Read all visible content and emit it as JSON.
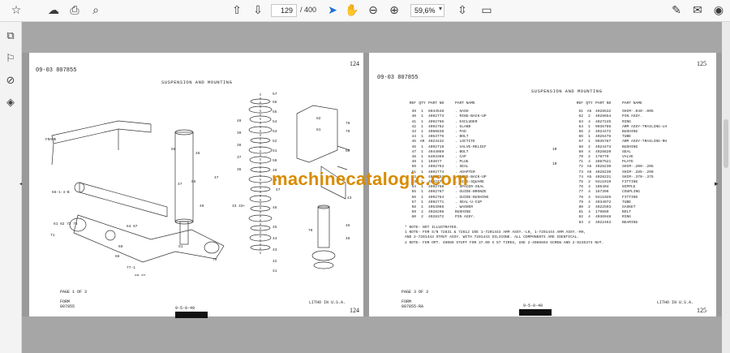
{
  "toolbar": {
    "current_page": "129",
    "total_pages": "/ 400",
    "zoom": "59,6%"
  },
  "left_page": {
    "header": "09-03  807855",
    "page_number_top": "124",
    "page_number_bottom": "124",
    "title": "SUSPENSION AND MOUNTING",
    "page_of": "PAGE 1 OF 3",
    "form_label": "FORM",
    "form_number": "807855",
    "date": "9-5-0-49",
    "litho": "LITHO IN U.S.A."
  },
  "right_page": {
    "header": "09-03  807855",
    "page_number_top": "125",
    "page_number_bottom": "125",
    "title": "SUSPENSION AND MOUNTING",
    "page_of": "PAGE 3 OF 3",
    "form_label": "FORM",
    "form_number": "807855-RA",
    "date": "9-5-0-49",
    "litho": "LITHO IN U.S.A.",
    "table_headers": {
      "ref": "REF",
      "qty": "QTY",
      "part": "PART NO",
      "name": "PART NAME"
    },
    "table_left": [
      {
        "ref": "39",
        "qty": "1",
        "part": "6044548",
        "name": ". HASH"
      },
      {
        "ref": "40",
        "qty": "1",
        "part": "4092773",
        "name": ". RING-BACK-UP"
      },
      {
        "ref": "41",
        "qty": "1",
        "part": "4092766",
        "name": ". EXCLUDER"
      },
      {
        "ref": "42",
        "qty": "1",
        "part": "4092762",
        "name": ". GLAND"
      },
      {
        "ref": "43",
        "qty": "1",
        "part": "4060838",
        "name": ". PAD"
      },
      {
        "ref": "44",
        "qty": "1",
        "part": "4053776",
        "name": ". BOLT"
      },
      {
        "ref": "45",
        "qty": "AR",
        "part": "4023432",
        "name": ". LOCTITE"
      },
      {
        "ref": "46",
        "qty": "1",
        "part": "4092719",
        "name": ". VALVE-RELIEF"
      },
      {
        "ref": "47",
        "qty": "1",
        "part": "4044059",
        "name": ". BOLT"
      },
      {
        "ref": "48",
        "qty": "1",
        "part": "8403369",
        "name": ". CAP"
      },
      {
        "ref": "49",
        "qty": "1",
        "part": "103677",
        "name": ". PLUG"
      },
      {
        "ref": "50",
        "qty": "1",
        "part": "4092763",
        "name": ". SEAL"
      },
      {
        "ref": "51",
        "qty": "1",
        "part": "4092774",
        "name": ". ADAPTER"
      },
      {
        "ref": "52",
        "qty": "1",
        "part": "4092753",
        "name": ". RING-BACK-UP"
      },
      {
        "ref": "53",
        "qty": "1",
        "part": "4092775",
        "name": ". RING-SQUARE"
      },
      {
        "ref": "54",
        "qty": "1",
        "part": "4092760",
        "name": ". SPACER-SEAL"
      },
      {
        "ref": "55",
        "qty": "1",
        "part": "4092767",
        "name": ". GUIDE-BRONZE"
      },
      {
        "ref": "56",
        "qty": "1",
        "part": "4092764",
        "name": ". GUIDE-BUSHING"
      },
      {
        "ref": "57",
        "qty": "1",
        "part": "4092771",
        "name": ". SEAL-U-CUP"
      },
      {
        "ref": "58",
        "qty": "1",
        "part": "4053986",
        "name": ". WASHER"
      },
      {
        "ref": "59",
        "qty": "2",
        "part": "4028298",
        "name": "BUSHING"
      },
      {
        "ref": "60",
        "qty": "2",
        "part": "4028372",
        "name": "PIN ASSY."
      }
    ],
    "table_right": [
      {
        "ref": "61",
        "qty": "A5",
        "part": "4028532",
        "name": "SHIM-.040-.005"
      },
      {
        "ref": "62",
        "qty": "2",
        "part": "4028654",
        "name": "PIN ASSY."
      },
      {
        "ref": "63",
        "qty": "4",
        "part": "4027245",
        "name": "RING"
      },
      {
        "ref": "64",
        "qty": "1",
        "part": "9035786",
        "name": "ARM ASSY-TRAILING-LH"
      },
      {
        "ref": "65",
        "qty": "2",
        "part": "4024472",
        "name": "BUSHING"
      },
      {
        "ref": "66",
        "qty": "1",
        "part": "4026476",
        "name": "TUBE"
      },
      {
        "ref": "67",
        "qty": "1",
        "part": "9035787",
        "name": "ARM ASSY-TRAILING-RH"
      },
      {
        "ref": "68",
        "qty": "2",
        "part": "4024473",
        "name": "BUSHING"
      },
      {
        "ref": "69",
        "qty": "4",
        "part": "4028820",
        "name": "SEAL"
      },
      {
        "ref": "70",
        "qty": "2",
        "part": "178779",
        "name": "VALVE"
      },
      {
        "ref": "71",
        "qty": "4",
        "part": "4087521",
        "name": "PLATE"
      },
      {
        "ref": "72",
        "qty": "A5",
        "part": "4028230",
        "name": "SHIM-.200-.205"
      },
      {
        "ref": "73",
        "qty": "A5",
        "part": "4028230",
        "name": "SHIM-.285-.290"
      },
      {
        "ref": "74",
        "qty": "A5",
        "part": "4028231",
        "name": "SHIM-.370-.375"
      },
      {
        "ref": "75",
        "qty": "2",
        "part": "9411019",
        "name": "FITTING"
      },
      {
        "ref": "76",
        "qty": "4",
        "part": "105404",
        "name": "NIPPLE"
      },
      {
        "ref": "77",
        "qty": "4",
        "part": "187396",
        "name": "COUPLING"
      },
      {
        "ref": "78",
        "qty": "4",
        "part": "9411026",
        "name": "FITTING"
      },
      {
        "ref": "79",
        "qty": "4",
        "part": "4034072",
        "name": "TUBE"
      },
      {
        "ref": "80",
        "qty": "2",
        "part": "4022593",
        "name": "GASKET"
      },
      {
        "ref": "81",
        "qty": "4",
        "part": "179889",
        "name": "BOLT"
      },
      {
        "ref": "82",
        "qty": "4",
        "part": "4036948",
        "name": "RING"
      },
      {
        "ref": "83",
        "qty": "2",
        "part": "4022463",
        "name": "BEARING"
      }
    ],
    "notes": [
      "*  NOTE- NOT ILLUSTRATED.",
      "1  NOTE- FOR S/N 72831 & 72612 USE 1-7201443 ARM ASSY.-LH, 1-7201444 ARM ASSY.-RH,",
      "          AND 2-7201443 STRUT ASSY. WITH 7201443 SILICONE.  ALL COMPONENTS ARE IDENTICAL.",
      "2  NOTE- FOR OPT. 49089 STUFF FOR 37.00 X 57 TIRES, USE 2-4086594 SCREW AND 2-9235374 NUT."
    ]
  },
  "watermark": "machinecatalogic.com"
}
